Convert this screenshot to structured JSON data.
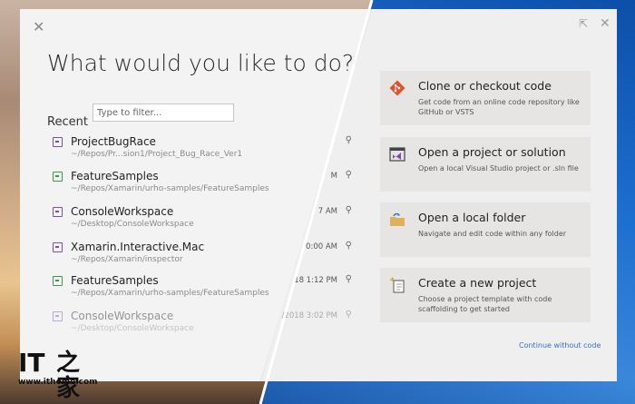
{
  "heading": "What would you like to do?",
  "recent": {
    "label": "Recent",
    "filter_placeholder": "Type to filter...",
    "items": [
      {
        "name": "ProjectBugRace",
        "path": "~/Repos/Pr...sion1/Project_Bug_Race_Ver1",
        "time": "",
        "icon": "solution-icon"
      },
      {
        "name": "FeatureSamples",
        "path": "~/Repos/Xamarin/urho-samples/FeatureSamples",
        "time": "M",
        "icon": "project-icon"
      },
      {
        "name": "ConsoleWorkspace",
        "path": "~/Desktop/ConsoleWorkspace",
        "time": "7 AM",
        "icon": "solution-icon"
      },
      {
        "name": "Xamarin.Interactive.Mac",
        "path": "~/Repos/Xamarin/inspector",
        "time": "0:00 AM",
        "icon": "solution-icon"
      },
      {
        "name": "FeatureSamples",
        "path": "~/Repos/Xamarin/urho-samples/FeatureSamples",
        "time": "18 1:12 PM",
        "icon": "project-icon"
      },
      {
        "name": "ConsoleWorkspace",
        "path": "~/Desktop/ConsoleWorkspace",
        "time": "/2018 3:02 PM",
        "icon": "solution-icon"
      }
    ]
  },
  "actions": [
    {
      "title": "Clone or checkout code",
      "desc": "Get code from an online code repository like GitHub or VSTS",
      "icon": "git-icon"
    },
    {
      "title": "Open a project or solution",
      "desc": "Open a local Visual Studio project or .sln file",
      "icon": "visual-studio-icon"
    },
    {
      "title": "Open a local folder",
      "desc": "Navigate and edit code within any folder",
      "icon": "folder-icon"
    },
    {
      "title": "Create a new project",
      "desc": "Choose a project template with code scaffolding to get started",
      "icon": "new-project-icon"
    }
  ],
  "continue_link": "Continue without code",
  "watermark": {
    "logo_text": "IT",
    "logo_cjk": "之家",
    "url": "www.ithome.com"
  },
  "colors": {
    "accent_link": "#2f73c9",
    "solution_icon": "#7a4fb0",
    "project_icon": "#3b9a4a",
    "git": "#e0512b"
  }
}
